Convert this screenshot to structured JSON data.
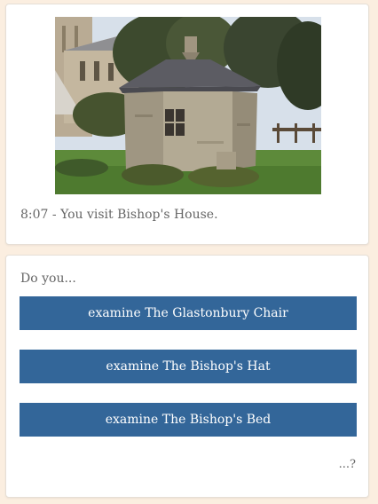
{
  "story": {
    "image_subject": "small stone octagonal house with slate roof beside a cathedral",
    "text": "8:07 - You visit Bishop's House."
  },
  "choices": {
    "prompt": "Do you...",
    "options": [
      "examine The Glastonbury Chair",
      "examine The Bishop's Hat",
      "examine The Bishop's Bed"
    ],
    "continuation": "...?"
  },
  "colors": {
    "page_background": "#fbeee0",
    "button": "#336699",
    "button_text": "#ffffff"
  }
}
